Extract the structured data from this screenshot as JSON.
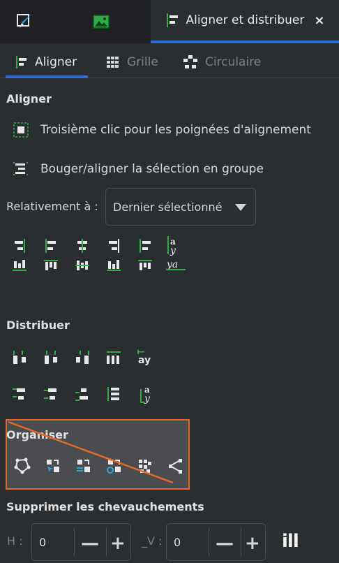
{
  "top_tabs": {
    "active_label": "Aligner et distribuer",
    "close": "×"
  },
  "sub_tabs": [
    {
      "label": "Aligner"
    },
    {
      "label": "Grille"
    },
    {
      "label": "Circulaire"
    }
  ],
  "align": {
    "heading": "Aligner",
    "option1": "Troisième clic pour les poignées d'alignement",
    "option2": "Bouger/aligner la sélection en groupe",
    "relative_label": "Relativement à :",
    "relative_value": "Dernier sélectionné"
  },
  "distribute": {
    "heading": "Distribuer"
  },
  "organise": {
    "heading": "Organiser"
  },
  "overlap": {
    "heading": "Supprimer les chevauchements",
    "h_label": "H :",
    "h_value": "0",
    "v_label": "_V :",
    "v_value": "0",
    "minus": "—",
    "plus": "+",
    "apply": "ill"
  },
  "glyphs": {
    "a_y": "ay",
    "y_a": "ya"
  },
  "colors": {
    "accent_blue": "#2e6fd1",
    "icon_green": "#2fae47",
    "highlight_orange": "#e2692c",
    "node_blue": "#2aa3e6"
  }
}
